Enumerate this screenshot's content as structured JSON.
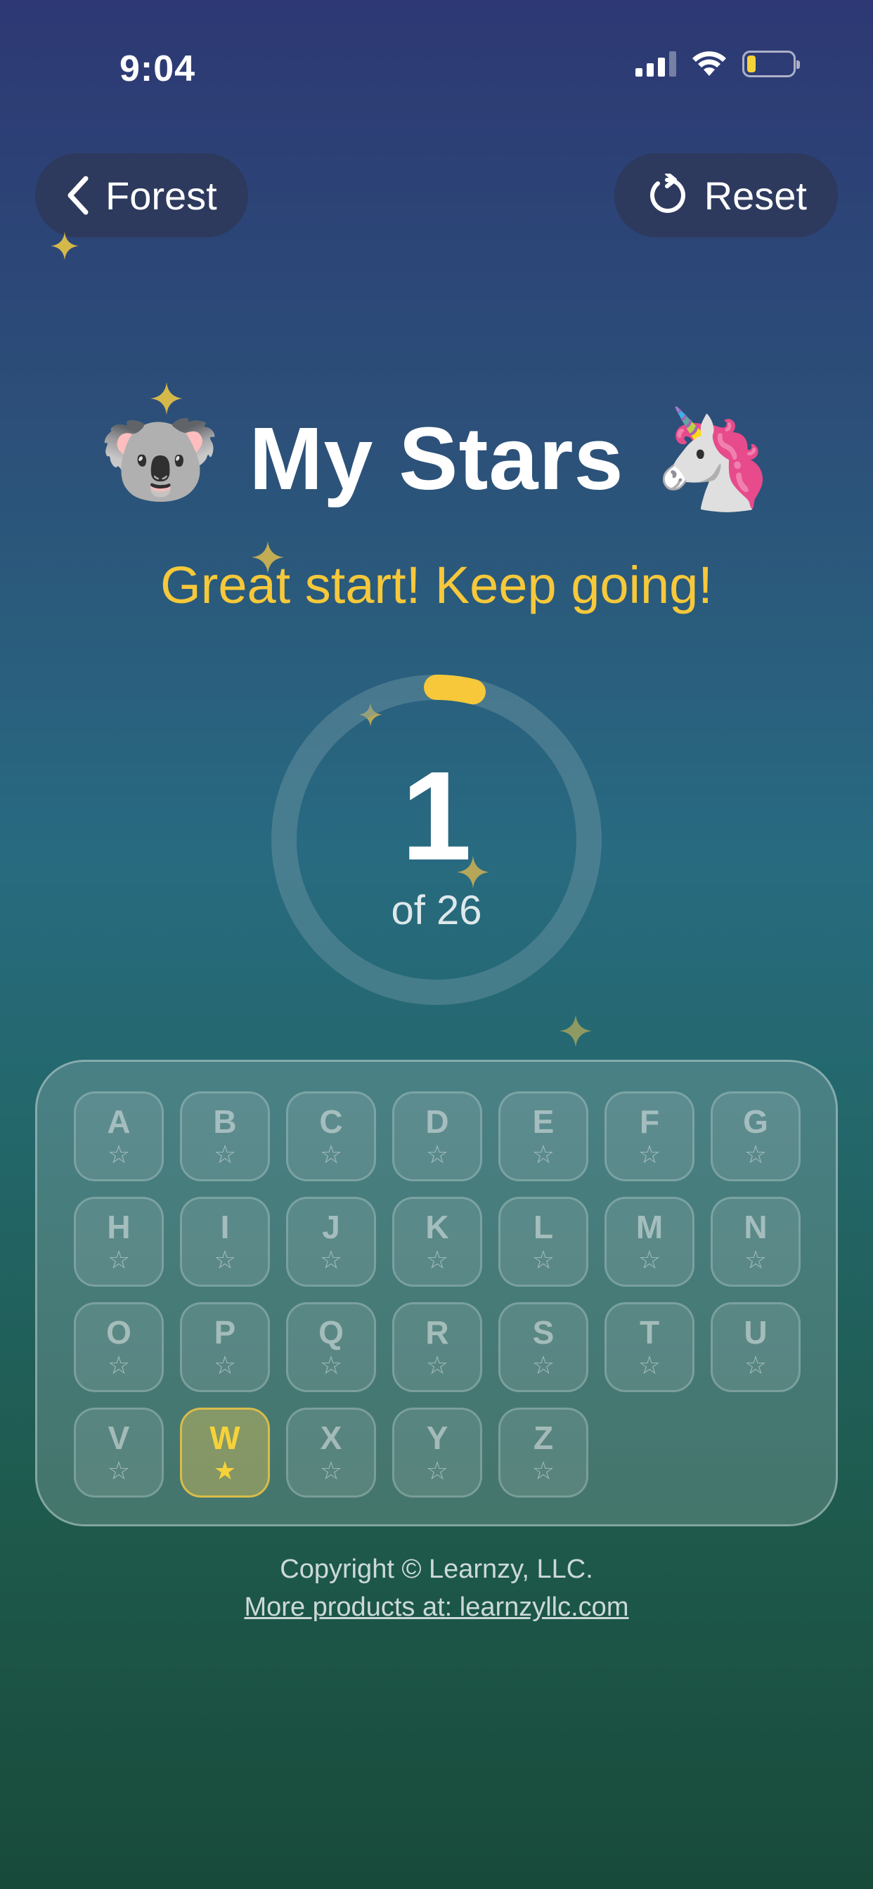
{
  "status_bar": {
    "time": "9:04"
  },
  "nav": {
    "back_label": "Forest",
    "reset_label": "Reset"
  },
  "header": {
    "title": "My Stars",
    "left_emoji": "🐨",
    "right_emoji": "🦄",
    "subtitle": "Great start! Keep going!"
  },
  "progress": {
    "count": "1",
    "total_label": "of 26",
    "fraction": 0.0385
  },
  "letters": [
    {
      "letter": "A",
      "star": "☆",
      "earned": false
    },
    {
      "letter": "B",
      "star": "☆",
      "earned": false
    },
    {
      "letter": "C",
      "star": "☆",
      "earned": false
    },
    {
      "letter": "D",
      "star": "☆",
      "earned": false
    },
    {
      "letter": "E",
      "star": "☆",
      "earned": false
    },
    {
      "letter": "F",
      "star": "☆",
      "earned": false
    },
    {
      "letter": "G",
      "star": "☆",
      "earned": false
    },
    {
      "letter": "H",
      "star": "☆",
      "earned": false
    },
    {
      "letter": "I",
      "star": "☆",
      "earned": false
    },
    {
      "letter": "J",
      "star": "☆",
      "earned": false
    },
    {
      "letter": "K",
      "star": "☆",
      "earned": false
    },
    {
      "letter": "L",
      "star": "☆",
      "earned": false
    },
    {
      "letter": "M",
      "star": "☆",
      "earned": false
    },
    {
      "letter": "N",
      "star": "☆",
      "earned": false
    },
    {
      "letter": "O",
      "star": "☆",
      "earned": false
    },
    {
      "letter": "P",
      "star": "☆",
      "earned": false
    },
    {
      "letter": "Q",
      "star": "☆",
      "earned": false
    },
    {
      "letter": "R",
      "star": "☆",
      "earned": false
    },
    {
      "letter": "S",
      "star": "☆",
      "earned": false
    },
    {
      "letter": "T",
      "star": "☆",
      "earned": false
    },
    {
      "letter": "U",
      "star": "☆",
      "earned": false
    },
    {
      "letter": "V",
      "star": "☆",
      "earned": false
    },
    {
      "letter": "W",
      "star": "★",
      "earned": true
    },
    {
      "letter": "X",
      "star": "☆",
      "earned": false
    },
    {
      "letter": "Y",
      "star": "☆",
      "earned": false
    },
    {
      "letter": "Z",
      "star": "☆",
      "earned": false
    }
  ],
  "footer": {
    "copyright": "Copyright © Learnzy, LLC.",
    "link_text": "More products at: learnzyllc.com"
  },
  "colors": {
    "accent": "#f6c83a",
    "ring_track": "#4a7c90"
  }
}
